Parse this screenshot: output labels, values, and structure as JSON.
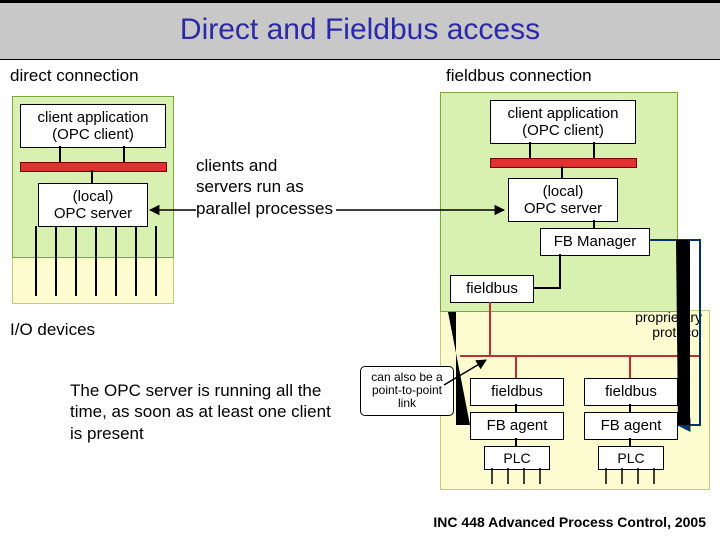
{
  "title": "Direct and Fieldbus access",
  "left_heading": "direct connection",
  "right_heading": "fieldbus connection",
  "left": {
    "client_line1": "client application",
    "client_line2": "(OPC client)",
    "server_line1": "(local)",
    "server_line2": "OPC server"
  },
  "right": {
    "client_line1": "client application",
    "client_line2": "(OPC client)",
    "server_line1": "(local)",
    "server_line2": "OPC server",
    "fb_manager": "FB Manager",
    "fieldbus": "fieldbus",
    "proprietary": "proprietary\nprotocol",
    "agent_fb": "fieldbus",
    "agent_mgr": "FB agent",
    "agent_plc": "PLC"
  },
  "center_note": "clients and servers run as parallel processes",
  "io_devices": "I/O devices",
  "bottom_note": "The OPC server is running all the time, as soon as at least one client is present",
  "ptp_note": "can also be a point-to-point link",
  "footer": "INC 448 Advanced Process Control, 2005"
}
